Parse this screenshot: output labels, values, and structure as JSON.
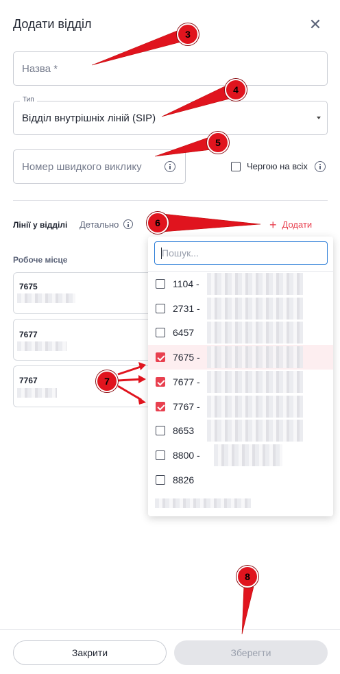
{
  "dialog": {
    "title": "Додати відділ",
    "close_icon": "close-icon"
  },
  "form": {
    "name_placeholder": "Назва *",
    "type_legend": "Тип",
    "type_value": "Відділ внутрішніх ліній (SIP)",
    "speed_dial_placeholder": "Номер швидкого виклику",
    "queue_all_label": "Чергою на всіх",
    "queue_all_checked": false
  },
  "lines": {
    "label": "Лінії у відділі",
    "detail_label": "Детально",
    "add_label": "Додати",
    "workplace_label": "Робоче місце",
    "cards": [
      {
        "number": "7675"
      },
      {
        "number": "7677"
      },
      {
        "number": "7767"
      }
    ]
  },
  "dropdown": {
    "search_placeholder": "Пошук...",
    "options": [
      {
        "label": "1104 -",
        "checked": false
      },
      {
        "label": "2731 -",
        "checked": false
      },
      {
        "label": "6457",
        "checked": false
      },
      {
        "label": "7675 -",
        "checked": true
      },
      {
        "label": "7677 -",
        "checked": true
      },
      {
        "label": "7767 -",
        "checked": true
      },
      {
        "label": "8653",
        "checked": false
      },
      {
        "label": "8800 -",
        "checked": false
      },
      {
        "label": "8826",
        "checked": false
      }
    ]
  },
  "footer": {
    "close_label": "Закрити",
    "save_label": "Зберегти"
  },
  "annotations": {
    "a3": "3",
    "a4": "4",
    "a5": "5",
    "a6": "6",
    "a7": "7",
    "a8": "8"
  },
  "colors": {
    "accent": "#e8404f",
    "annotation": "#e0141e",
    "focus": "#2f7fd8"
  }
}
